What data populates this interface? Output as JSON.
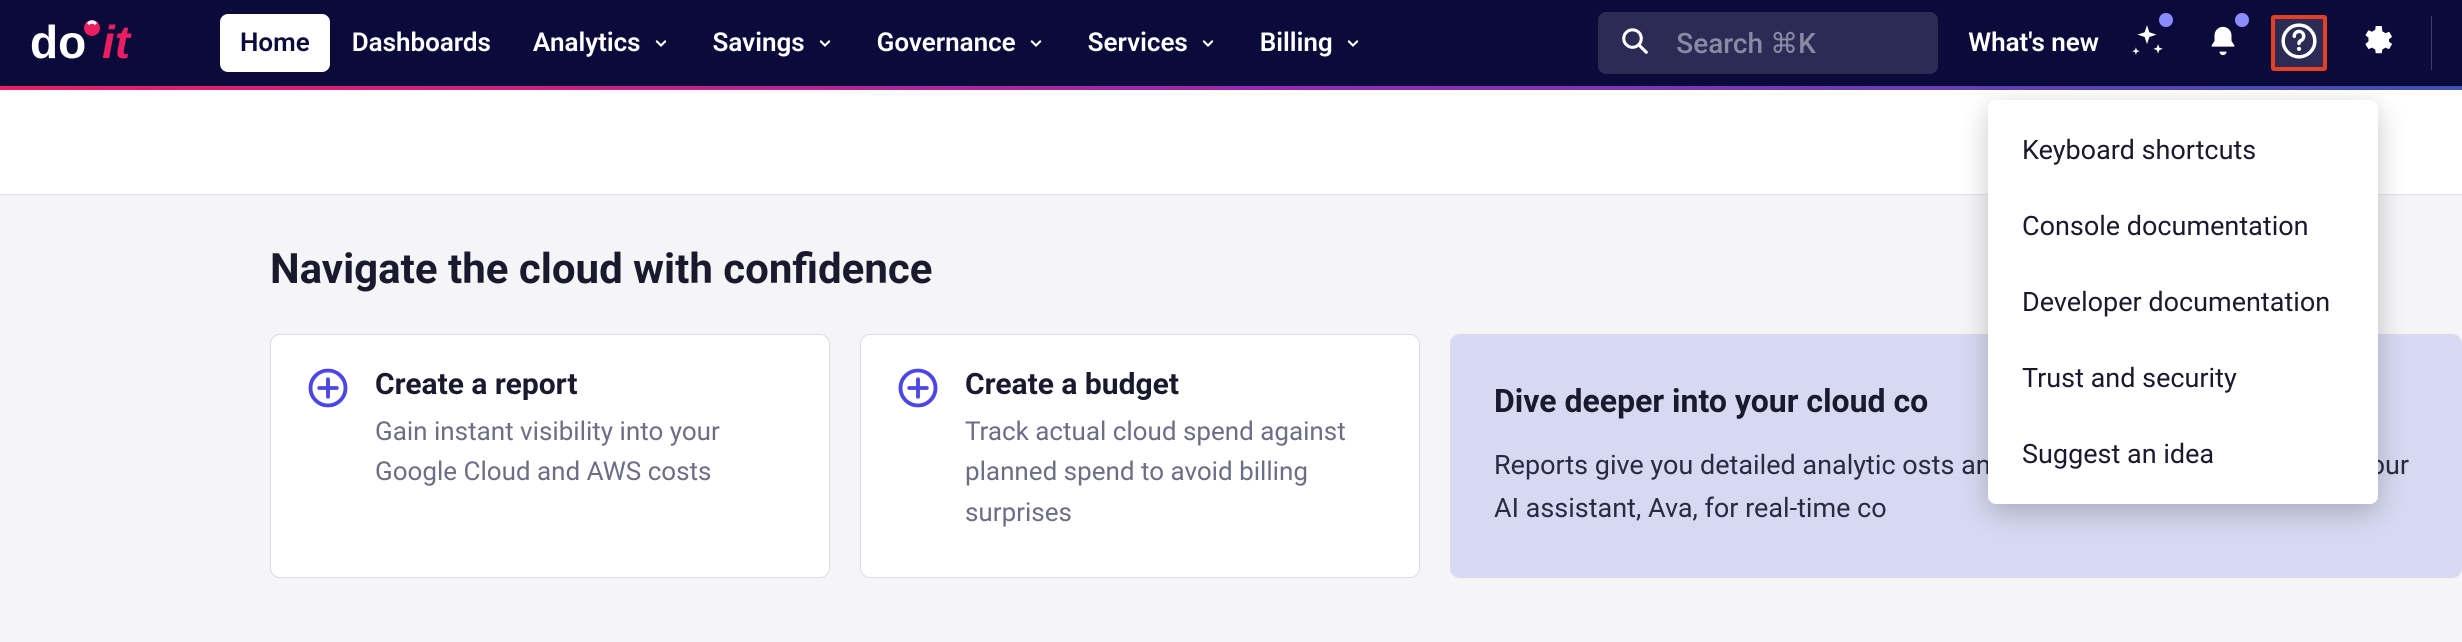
{
  "nav": {
    "items": [
      {
        "label": "Home",
        "active": true,
        "hasDropdown": false
      },
      {
        "label": "Dashboards",
        "active": false,
        "hasDropdown": false
      },
      {
        "label": "Analytics",
        "active": false,
        "hasDropdown": true
      },
      {
        "label": "Savings",
        "active": false,
        "hasDropdown": true
      },
      {
        "label": "Governance",
        "active": false,
        "hasDropdown": true
      },
      {
        "label": "Services",
        "active": false,
        "hasDropdown": true
      },
      {
        "label": "Billing",
        "active": false,
        "hasDropdown": true
      }
    ]
  },
  "search": {
    "placeholder": "Search ⌘K"
  },
  "header": {
    "whats_new": "What's new"
  },
  "helpMenu": {
    "items": [
      {
        "label": "Keyboard shortcuts"
      },
      {
        "label": "Console documentation"
      },
      {
        "label": "Developer documentation"
      },
      {
        "label": "Trust and security"
      },
      {
        "label": "Suggest an idea"
      }
    ]
  },
  "main": {
    "title": "Navigate the cloud with confidence",
    "cards": [
      {
        "title": "Create a report",
        "desc": "Gain instant visibility into your Google Cloud and AWS costs"
      },
      {
        "title": "Create a budget",
        "desc": "Track actual cloud spend against planned spend to avoid billing surprises"
      }
    ],
    "info": {
      "title": "Dive deeper into your cloud co",
      "desc": "Reports give you detailed analytic                                             osts an performance. Try it now or use our AI assistant, Ava, for real-time co"
    }
  },
  "colors": {
    "headerBg": "#0b0b3b",
    "accent": "#4b46e6",
    "highlight": "#e73f23"
  }
}
